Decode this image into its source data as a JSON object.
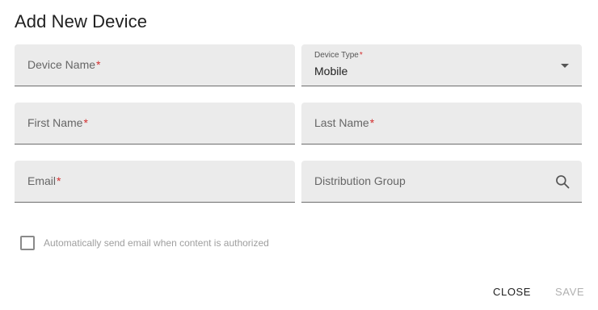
{
  "dialog": {
    "title": "Add New Device"
  },
  "fields": {
    "device_name": {
      "label": "Device Name",
      "required_mark": "*"
    },
    "device_type": {
      "label": "Device Type",
      "required_mark": "*",
      "value": "Mobile"
    },
    "first_name": {
      "label": "First Name",
      "required_mark": "*"
    },
    "last_name": {
      "label": "Last Name",
      "required_mark": "*"
    },
    "email": {
      "label": "Email",
      "required_mark": "*"
    },
    "distribution_group": {
      "label": "Distribution Group",
      "icon": "search-icon"
    }
  },
  "options": {
    "auto_email_label": "Automatically send email when content is authorized",
    "auto_email_checked": false
  },
  "actions": {
    "close_label": "CLOSE",
    "save_label": "SAVE",
    "save_enabled": false
  },
  "colors": {
    "field_bg": "#ebebeb",
    "required": "#d32f2f",
    "disabled_text": "#b0b0b0"
  }
}
